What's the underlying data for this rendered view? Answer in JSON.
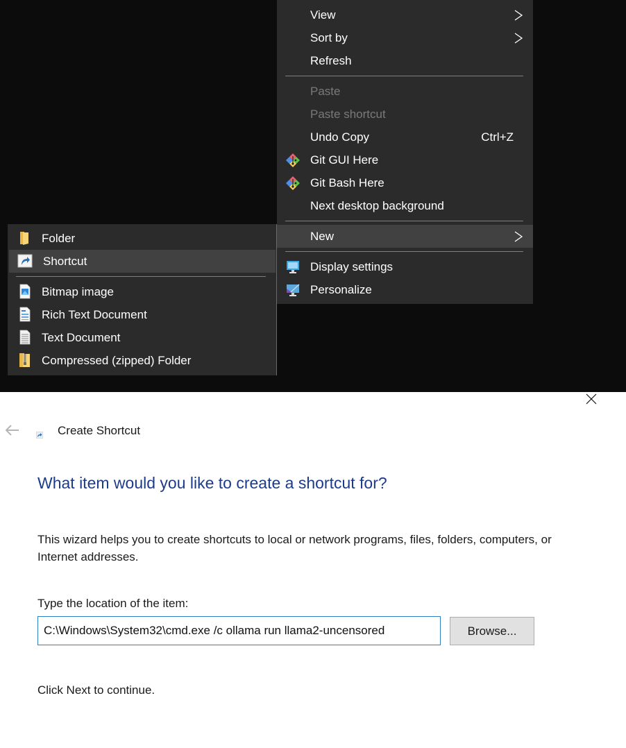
{
  "context_menu": {
    "items": [
      {
        "label": "View",
        "submenu": true
      },
      {
        "label": "Sort by",
        "submenu": true
      },
      {
        "label": "Refresh"
      },
      {
        "label": "Paste",
        "disabled": true
      },
      {
        "label": "Paste shortcut",
        "disabled": true
      },
      {
        "label": "Undo Copy",
        "accelerator": "Ctrl+Z"
      },
      {
        "label": "Git GUI Here",
        "icon": "git-gui-icon"
      },
      {
        "label": "Git Bash Here",
        "icon": "git-bash-icon"
      },
      {
        "label": "Next desktop background"
      },
      {
        "label": "New",
        "submenu": true,
        "highlighted": true
      },
      {
        "label": "Display settings",
        "icon": "display-settings-icon"
      },
      {
        "label": "Personalize",
        "icon": "personalize-icon"
      }
    ]
  },
  "new_submenu": {
    "items": [
      {
        "label": "Folder",
        "icon": "folder-icon"
      },
      {
        "label": "Shortcut",
        "icon": "shortcut-icon",
        "highlighted": true
      },
      {
        "label": "Bitmap image",
        "icon": "bitmap-icon"
      },
      {
        "label": "Rich Text Document",
        "icon": "rich-text-icon"
      },
      {
        "label": "Text Document",
        "icon": "text-document-icon"
      },
      {
        "label": "Compressed (zipped) Folder",
        "icon": "zip-folder-icon"
      }
    ]
  },
  "wizard": {
    "title": "Create Shortcut",
    "heading": "What item would you like to create a shortcut for?",
    "description": "This wizard helps you to create shortcuts to local or network programs, files, folders, computers, or Internet addresses.",
    "location_label": "Type the location of the item:",
    "location_value": "C:\\Windows\\System32\\cmd.exe /c ollama run llama2-uncensored",
    "browse_label": "Browse...",
    "continue_text": "Click Next to continue."
  },
  "colors": {
    "menu_bg": "#2b2b2b",
    "menu_hover": "#414141",
    "heading_blue": "#1c3b8c",
    "input_border": "#2f7fc4"
  }
}
